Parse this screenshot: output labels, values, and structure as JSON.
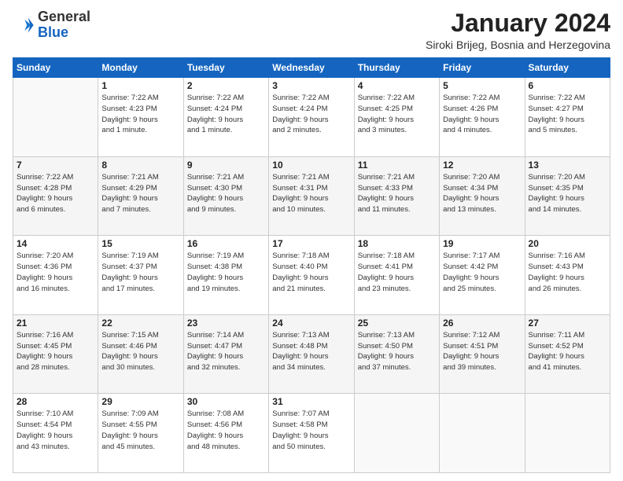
{
  "header": {
    "logo_general": "General",
    "logo_blue": "Blue",
    "month_title": "January 2024",
    "location": "Siroki Brijeg, Bosnia and Herzegovina"
  },
  "days_of_week": [
    "Sunday",
    "Monday",
    "Tuesday",
    "Wednesday",
    "Thursday",
    "Friday",
    "Saturday"
  ],
  "weeks": [
    [
      {
        "day": "",
        "info": ""
      },
      {
        "day": "1",
        "info": "Sunrise: 7:22 AM\nSunset: 4:23 PM\nDaylight: 9 hours\nand 1 minute."
      },
      {
        "day": "2",
        "info": "Sunrise: 7:22 AM\nSunset: 4:24 PM\nDaylight: 9 hours\nand 1 minute."
      },
      {
        "day": "3",
        "info": "Sunrise: 7:22 AM\nSunset: 4:24 PM\nDaylight: 9 hours\nand 2 minutes."
      },
      {
        "day": "4",
        "info": "Sunrise: 7:22 AM\nSunset: 4:25 PM\nDaylight: 9 hours\nand 3 minutes."
      },
      {
        "day": "5",
        "info": "Sunrise: 7:22 AM\nSunset: 4:26 PM\nDaylight: 9 hours\nand 4 minutes."
      },
      {
        "day": "6",
        "info": "Sunrise: 7:22 AM\nSunset: 4:27 PM\nDaylight: 9 hours\nand 5 minutes."
      }
    ],
    [
      {
        "day": "7",
        "info": "Sunrise: 7:22 AM\nSunset: 4:28 PM\nDaylight: 9 hours\nand 6 minutes."
      },
      {
        "day": "8",
        "info": "Sunrise: 7:21 AM\nSunset: 4:29 PM\nDaylight: 9 hours\nand 7 minutes."
      },
      {
        "day": "9",
        "info": "Sunrise: 7:21 AM\nSunset: 4:30 PM\nDaylight: 9 hours\nand 9 minutes."
      },
      {
        "day": "10",
        "info": "Sunrise: 7:21 AM\nSunset: 4:31 PM\nDaylight: 9 hours\nand 10 minutes."
      },
      {
        "day": "11",
        "info": "Sunrise: 7:21 AM\nSunset: 4:33 PM\nDaylight: 9 hours\nand 11 minutes."
      },
      {
        "day": "12",
        "info": "Sunrise: 7:20 AM\nSunset: 4:34 PM\nDaylight: 9 hours\nand 13 minutes."
      },
      {
        "day": "13",
        "info": "Sunrise: 7:20 AM\nSunset: 4:35 PM\nDaylight: 9 hours\nand 14 minutes."
      }
    ],
    [
      {
        "day": "14",
        "info": "Sunrise: 7:20 AM\nSunset: 4:36 PM\nDaylight: 9 hours\nand 16 minutes."
      },
      {
        "day": "15",
        "info": "Sunrise: 7:19 AM\nSunset: 4:37 PM\nDaylight: 9 hours\nand 17 minutes."
      },
      {
        "day": "16",
        "info": "Sunrise: 7:19 AM\nSunset: 4:38 PM\nDaylight: 9 hours\nand 19 minutes."
      },
      {
        "day": "17",
        "info": "Sunrise: 7:18 AM\nSunset: 4:40 PM\nDaylight: 9 hours\nand 21 minutes."
      },
      {
        "day": "18",
        "info": "Sunrise: 7:18 AM\nSunset: 4:41 PM\nDaylight: 9 hours\nand 23 minutes."
      },
      {
        "day": "19",
        "info": "Sunrise: 7:17 AM\nSunset: 4:42 PM\nDaylight: 9 hours\nand 25 minutes."
      },
      {
        "day": "20",
        "info": "Sunrise: 7:16 AM\nSunset: 4:43 PM\nDaylight: 9 hours\nand 26 minutes."
      }
    ],
    [
      {
        "day": "21",
        "info": "Sunrise: 7:16 AM\nSunset: 4:45 PM\nDaylight: 9 hours\nand 28 minutes."
      },
      {
        "day": "22",
        "info": "Sunrise: 7:15 AM\nSunset: 4:46 PM\nDaylight: 9 hours\nand 30 minutes."
      },
      {
        "day": "23",
        "info": "Sunrise: 7:14 AM\nSunset: 4:47 PM\nDaylight: 9 hours\nand 32 minutes."
      },
      {
        "day": "24",
        "info": "Sunrise: 7:13 AM\nSunset: 4:48 PM\nDaylight: 9 hours\nand 34 minutes."
      },
      {
        "day": "25",
        "info": "Sunrise: 7:13 AM\nSunset: 4:50 PM\nDaylight: 9 hours\nand 37 minutes."
      },
      {
        "day": "26",
        "info": "Sunrise: 7:12 AM\nSunset: 4:51 PM\nDaylight: 9 hours\nand 39 minutes."
      },
      {
        "day": "27",
        "info": "Sunrise: 7:11 AM\nSunset: 4:52 PM\nDaylight: 9 hours\nand 41 minutes."
      }
    ],
    [
      {
        "day": "28",
        "info": "Sunrise: 7:10 AM\nSunset: 4:54 PM\nDaylight: 9 hours\nand 43 minutes."
      },
      {
        "day": "29",
        "info": "Sunrise: 7:09 AM\nSunset: 4:55 PM\nDaylight: 9 hours\nand 45 minutes."
      },
      {
        "day": "30",
        "info": "Sunrise: 7:08 AM\nSunset: 4:56 PM\nDaylight: 9 hours\nand 48 minutes."
      },
      {
        "day": "31",
        "info": "Sunrise: 7:07 AM\nSunset: 4:58 PM\nDaylight: 9 hours\nand 50 minutes."
      },
      {
        "day": "",
        "info": ""
      },
      {
        "day": "",
        "info": ""
      },
      {
        "day": "",
        "info": ""
      }
    ]
  ]
}
